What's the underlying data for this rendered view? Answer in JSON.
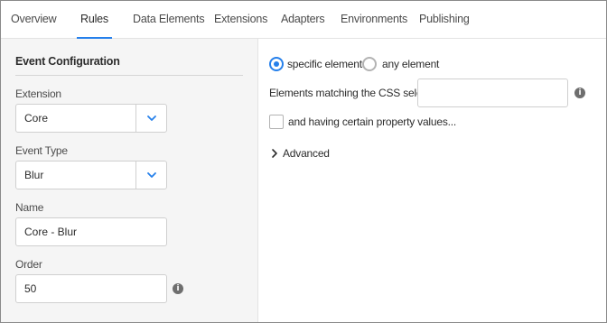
{
  "tabs": [
    {
      "label": "Overview",
      "active": false
    },
    {
      "label": "Rules",
      "active": true
    },
    {
      "label": "Data Elements",
      "active": false
    },
    {
      "label": "Extensions",
      "active": false
    },
    {
      "label": "Adapters",
      "active": false
    },
    {
      "label": "Environments",
      "active": false
    },
    {
      "label": "Publishing",
      "active": false
    }
  ],
  "left": {
    "section_title": "Event Configuration",
    "extension": {
      "label": "Extension",
      "value": "Core"
    },
    "event_type": {
      "label": "Event Type",
      "value": "Blur"
    },
    "name": {
      "label": "Name",
      "value": "Core - Blur"
    },
    "order": {
      "label": "Order",
      "value": "50"
    },
    "info_glyph": "i"
  },
  "right": {
    "radio_specific": {
      "label": "specific elements",
      "checked": true
    },
    "radio_any": {
      "label": "any element",
      "checked": false
    },
    "css_selector": {
      "label": "Elements matching the CSS selector",
      "value": ""
    },
    "property_values": {
      "label": "and having certain property values...",
      "checked": false
    },
    "advanced": {
      "label": "Advanced",
      "expanded": false
    }
  },
  "colors": {
    "accent": "#2680eb",
    "panel_bg": "#f5f5f5",
    "border": "#cfcfcf"
  }
}
